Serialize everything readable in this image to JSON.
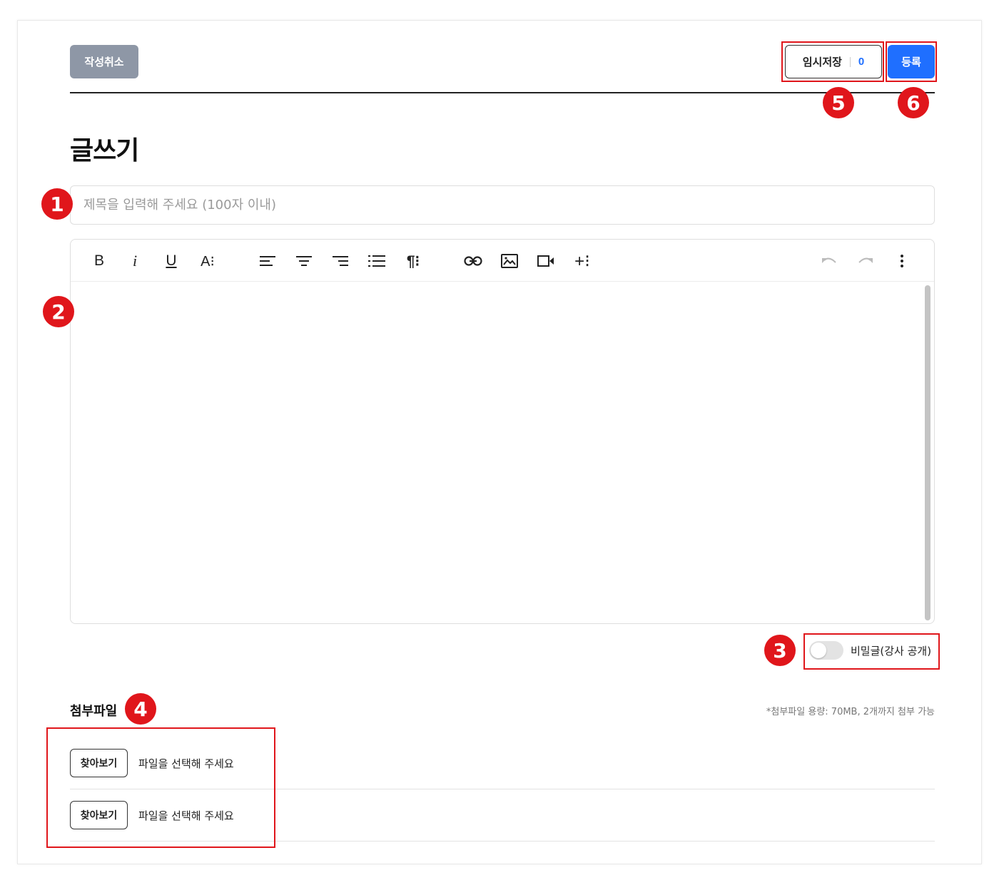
{
  "header": {
    "cancel_label": "작성취소",
    "temp_save_label": "임시저장",
    "temp_save_count": "0",
    "submit_label": "등록"
  },
  "page": {
    "title": "글쓰기"
  },
  "title_field": {
    "placeholder": "제목을 입력해 주세요 (100자 이내)",
    "value": ""
  },
  "editor": {
    "toolbar": [
      {
        "name": "bold",
        "glyph": "B"
      },
      {
        "name": "italic",
        "glyph": "i"
      },
      {
        "name": "underline",
        "glyph": "U"
      },
      {
        "name": "font-size",
        "glyph": "A⁝"
      },
      {
        "name": "align-left"
      },
      {
        "name": "align-center"
      },
      {
        "name": "align-right"
      },
      {
        "name": "ordered-list"
      },
      {
        "name": "paragraph",
        "glyph": "¶⁝"
      },
      {
        "name": "link"
      },
      {
        "name": "image"
      },
      {
        "name": "video"
      },
      {
        "name": "insert-more",
        "glyph": "+⁝"
      },
      {
        "name": "undo"
      },
      {
        "name": "redo"
      },
      {
        "name": "more-options"
      }
    ],
    "content": ""
  },
  "secret": {
    "label": "비밀글(강사 공개)",
    "enabled": false
  },
  "attachments": {
    "title": "첨부파일",
    "note": "*첨부파일 용량: 70MB, 2개까지 첨부 가능",
    "rows": [
      {
        "button_label": "찾아보기",
        "placeholder": "파일을 선택해 주세요"
      },
      {
        "button_label": "찾아보기",
        "placeholder": "파일을 선택해 주세요"
      }
    ]
  },
  "annotations": [
    "1",
    "2",
    "3",
    "4",
    "5",
    "6"
  ],
  "colors": {
    "accent": "#1f6fff",
    "annotation": "#e0161b",
    "cancel_bg": "#8e97a6"
  }
}
